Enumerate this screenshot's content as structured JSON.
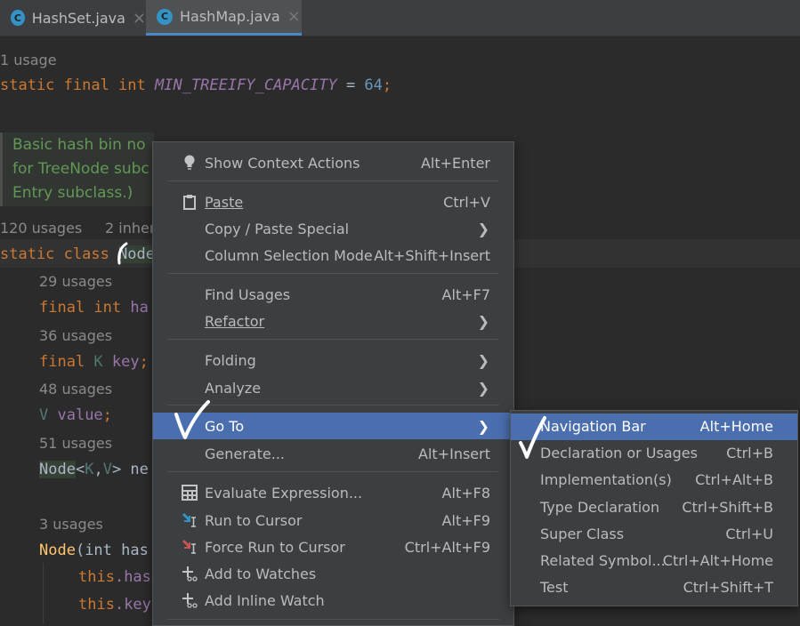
{
  "tabs": [
    {
      "label": "HashSet.java",
      "icon": "class-c-icon",
      "active": false
    },
    {
      "label": "HashMap.java",
      "icon": "class-c-icon",
      "active": true
    }
  ],
  "editor": {
    "usage_1": "1 usage",
    "line_treeify_kw": "static final int ",
    "line_treeify_const": "MIN_TREEIFY_CAPACITY",
    "line_treeify_eq": " = ",
    "line_treeify_num": "64",
    "line_treeify_end": ";",
    "doc_line1": "Basic hash bin no",
    "doc_line2": "for TreeNode subc",
    "doc_line3": "Entry subclass.)",
    "usages_120": "120 usages",
    "inher": "2 inher",
    "class_kw": "static class ",
    "class_name": "Node",
    "usages_29": "29 usages",
    "final_int": "final int ",
    "ha": "ha",
    "usages_36": "36 usages",
    "final_k": "final ",
    "K": "K",
    "key": " key",
    "semi": ";",
    "usages_48": "48 usages",
    "V": "V",
    "value": " value",
    "usages_51": "51 usages",
    "node_generic": "Node",
    "lt": "<",
    "comma": ",",
    "gt": "> ne",
    "usages_3": "3 usages",
    "ctor": "Node",
    "ctor_args": "(int has",
    "this": "this",
    "this_has": ".has",
    "this_key": ".key"
  },
  "context_menu": {
    "items": [
      {
        "label": "Show Context Actions",
        "shortcut": "Alt+Enter",
        "icon": "lightbulb-icon"
      },
      {
        "label": "Paste",
        "shortcut": "Ctrl+V",
        "icon": "clipboard-icon"
      },
      {
        "label": "Copy / Paste Special",
        "shortcut": "",
        "submenu": true
      },
      {
        "label": "Column Selection Mode",
        "shortcut": "Alt+Shift+Insert"
      },
      {
        "label": "Find Usages",
        "shortcut": "Alt+F7"
      },
      {
        "label": "Refactor",
        "shortcut": "",
        "submenu": true
      },
      {
        "label": "Folding",
        "shortcut": "",
        "submenu": true
      },
      {
        "label": "Analyze",
        "shortcut": "",
        "submenu": true
      },
      {
        "label": "Go To",
        "shortcut": "",
        "submenu": true,
        "selected": true
      },
      {
        "label": "Generate...",
        "shortcut": "Alt+Insert"
      },
      {
        "label": "Evaluate Expression...",
        "shortcut": "Alt+F8",
        "icon": "calculator-icon"
      },
      {
        "label": "Run to Cursor",
        "shortcut": "Alt+F9",
        "icon": "run-to-cursor-icon"
      },
      {
        "label": "Force Run to Cursor",
        "shortcut": "Ctrl+Alt+F9",
        "icon": "force-run-to-cursor-icon"
      },
      {
        "label": "Add to Watches",
        "shortcut": "",
        "icon": "add-watch-icon"
      },
      {
        "label": "Add Inline Watch",
        "shortcut": "",
        "icon": "add-inline-watch-icon"
      }
    ]
  },
  "goto_submenu": {
    "items": [
      {
        "label": "Navigation Bar",
        "shortcut": "Alt+Home",
        "selected": true
      },
      {
        "label": "Declaration or Usages",
        "shortcut": "Ctrl+B"
      },
      {
        "label": "Implementation(s)",
        "shortcut": "Ctrl+Alt+B"
      },
      {
        "label": "Type Declaration",
        "shortcut": "Ctrl+Shift+B"
      },
      {
        "label": "Super Class",
        "shortcut": "Ctrl+U"
      },
      {
        "label": "Related Symbol...",
        "shortcut": "Ctrl+Alt+Home"
      },
      {
        "label": "Test",
        "shortcut": "Ctrl+Shift+T"
      }
    ]
  },
  "colors": {
    "selection": "#4b6eaf",
    "menu_bg": "#3c3f41",
    "editor_bg": "#2b2b2b",
    "keyword": "#cc7832",
    "constant": "#9876aa",
    "doc_comment": "#629755"
  }
}
